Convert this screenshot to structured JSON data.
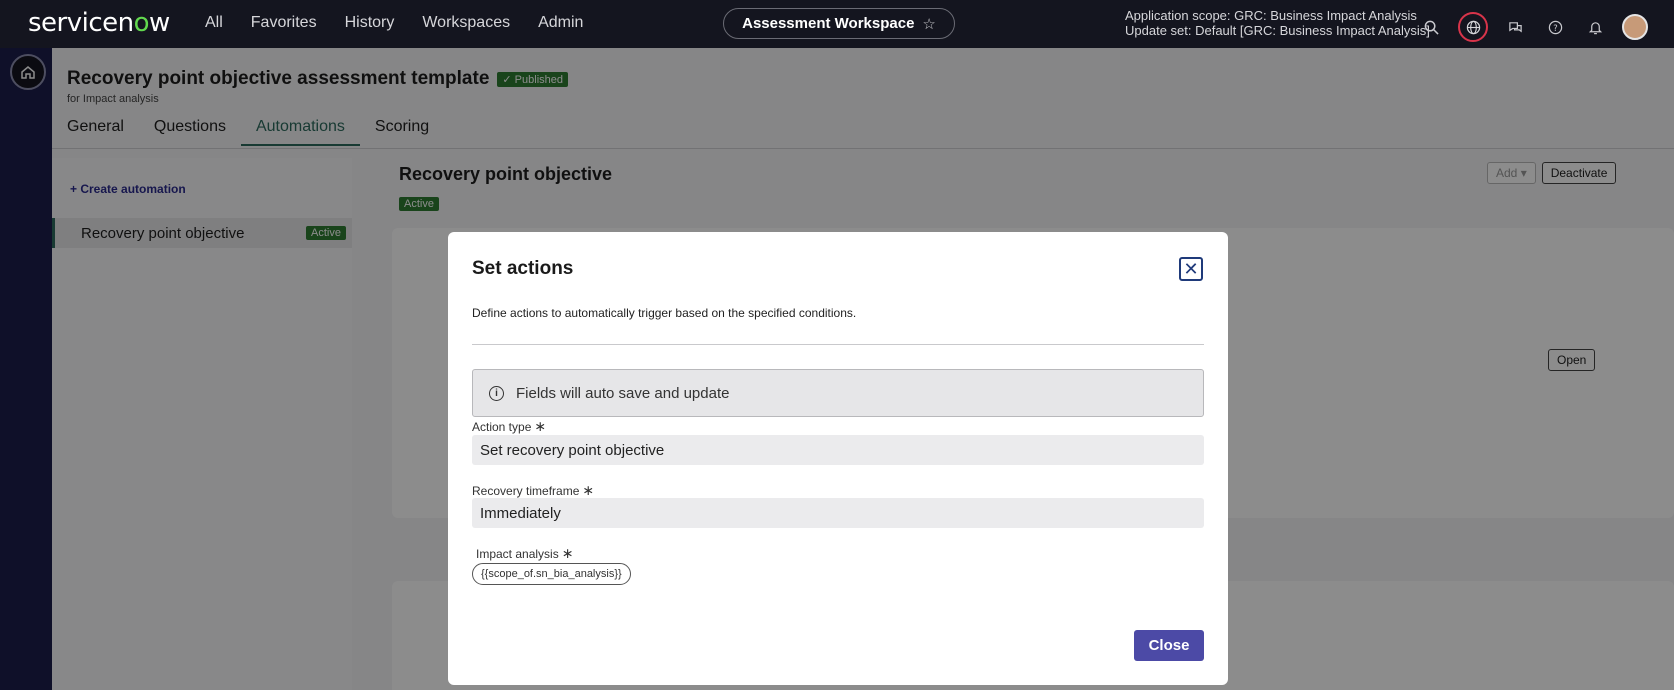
{
  "topnav": {
    "logo": "servicenow",
    "links": [
      "All",
      "Favorites",
      "History",
      "Workspaces",
      "Admin"
    ],
    "workspace_pill": "Assessment Workspace",
    "scope_line1": "Application scope: GRC: Business Impact Analysis",
    "scope_line2": "Update set: Default [GRC: Business Impact Analysis]",
    "icons": [
      "search-icon",
      "globe-icon",
      "chat-icon",
      "help-icon",
      "bell-icon",
      "avatar"
    ]
  },
  "page": {
    "title": "Recovery point objective assessment template",
    "published_badge": "Published",
    "subtitle": "for Impact analysis",
    "tabs": [
      "General",
      "Questions",
      "Automations",
      "Scoring"
    ],
    "active_tab": "Automations",
    "create_automation": "+ Create automation",
    "side_item": "Recovery point objective",
    "side_item_badge": "Active",
    "main_title": "Recovery point objective",
    "main_badge": "Active",
    "add_btn": "Add",
    "deactivate_btn": "Deactivate",
    "open_btn": "Open"
  },
  "modal": {
    "title": "Set actions",
    "description": "Define actions to automatically trigger based on the specified conditions.",
    "info": "Fields will auto save and update",
    "action_type_label": "Action type",
    "action_type_value": "Set recovery point objective",
    "recovery_label": "Recovery timeframe",
    "recovery_value": "Immediately",
    "impact_label": "Impact analysis",
    "impact_pill": "{{scope_of.sn_bia_analysis}}",
    "close_btn": "Close",
    "required_mark": "∗"
  }
}
